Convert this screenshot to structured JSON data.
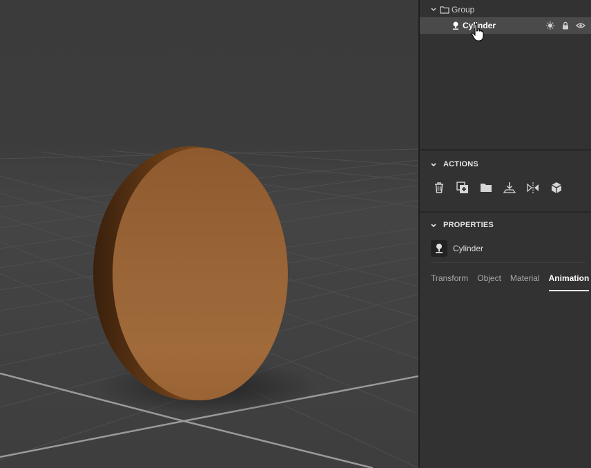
{
  "layers": {
    "group_label": "Group",
    "item_label": "Cylinder"
  },
  "actions": {
    "title": "ACTIONS",
    "icons": [
      "trash-icon",
      "duplicate-icon",
      "folder-icon",
      "import-icon",
      "mirror-icon",
      "cube-icon"
    ]
  },
  "properties": {
    "title": "PROPERTIES",
    "selected_name": "Cylinder",
    "tabs": [
      "Transform",
      "Object",
      "Material",
      "Animation"
    ],
    "active_tab": "Animation"
  },
  "colors": {
    "panel_bg": "#323232",
    "selected_row": "#4a4a4a",
    "viewport_bg": "#3e3e3e",
    "object_face": "#a06a3a"
  }
}
